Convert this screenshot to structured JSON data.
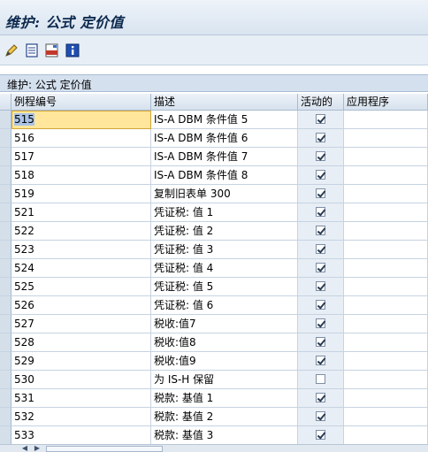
{
  "window": {
    "title": "维护: 公式 定价值"
  },
  "toolbar": {
    "buttons": [
      "edit-icon",
      "display-icon",
      "print-icon",
      "info-icon"
    ]
  },
  "panel": {
    "title": "维护: 公式 定价值"
  },
  "table": {
    "columns": [
      "例程编号",
      "描述",
      "活动的",
      "应用程序"
    ],
    "rows": [
      {
        "num": "515",
        "desc": "IS-A DBM 条件值 5",
        "active": true
      },
      {
        "num": "516",
        "desc": "IS-A DBM 条件值 6",
        "active": true
      },
      {
        "num": "517",
        "desc": "IS-A DBM 条件值 7",
        "active": true
      },
      {
        "num": "518",
        "desc": "IS-A DBM 条件值 8",
        "active": true
      },
      {
        "num": "519",
        "desc": "复制旧表单 300",
        "active": true
      },
      {
        "num": "521",
        "desc": "凭证税: 值 1",
        "active": true
      },
      {
        "num": "522",
        "desc": "凭证税: 值 2",
        "active": true
      },
      {
        "num": "523",
        "desc": "凭证税: 值 3",
        "active": true
      },
      {
        "num": "524",
        "desc": "凭证税: 值 4",
        "active": true
      },
      {
        "num": "525",
        "desc": "凭证税: 值 5",
        "active": true
      },
      {
        "num": "526",
        "desc": "凭证税: 值 6",
        "active": true
      },
      {
        "num": "527",
        "desc": "税收:值7",
        "active": true
      },
      {
        "num": "528",
        "desc": "税收:值8",
        "active": true
      },
      {
        "num": "529",
        "desc": "税收:值9",
        "active": true
      },
      {
        "num": "530",
        "desc": "为 IS-H 保留",
        "active": false
      },
      {
        "num": "531",
        "desc": "税款: 基值 1",
        "active": true
      },
      {
        "num": "532",
        "desc": "税款: 基值 2",
        "active": true
      },
      {
        "num": "533",
        "desc": "税款: 基值 3",
        "active": true
      }
    ]
  }
}
